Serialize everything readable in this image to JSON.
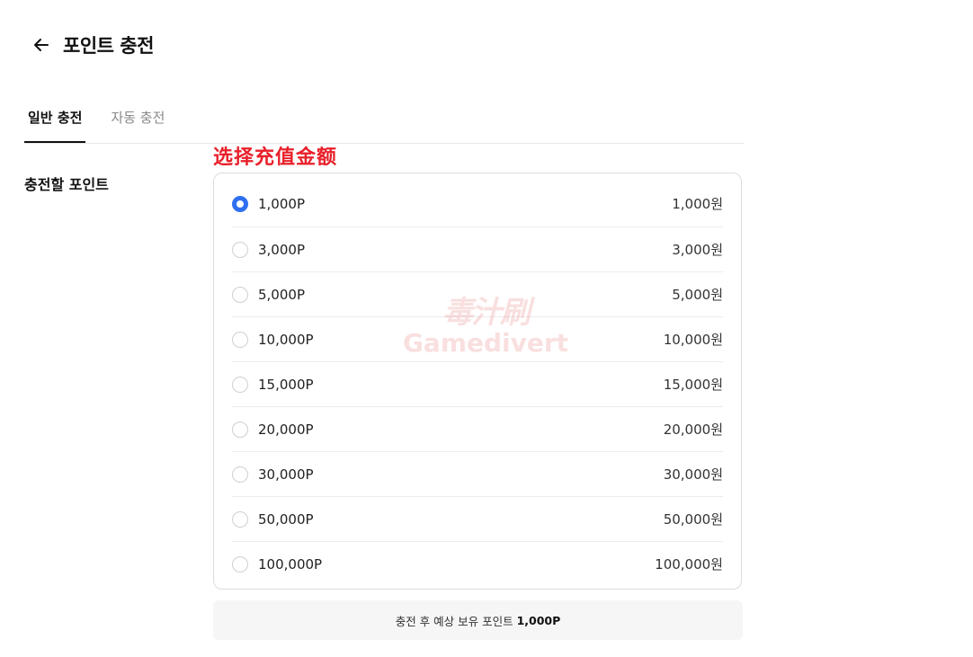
{
  "header": {
    "title": "포인트 충전"
  },
  "tabs": [
    {
      "label": "일반 충전",
      "active": true
    },
    {
      "label": "자동 충전",
      "active": false
    }
  ],
  "section_label": "충전할 포인트",
  "annotation": "选择充值金额",
  "options": [
    {
      "label": "1,000P",
      "price": "1,000원",
      "selected": true
    },
    {
      "label": "3,000P",
      "price": "3,000원",
      "selected": false
    },
    {
      "label": "5,000P",
      "price": "5,000원",
      "selected": false
    },
    {
      "label": "10,000P",
      "price": "10,000원",
      "selected": false
    },
    {
      "label": "15,000P",
      "price": "15,000원",
      "selected": false
    },
    {
      "label": "20,000P",
      "price": "20,000원",
      "selected": false
    },
    {
      "label": "30,000P",
      "price": "30,000원",
      "selected": false
    },
    {
      "label": "50,000P",
      "price": "50,000원",
      "selected": false
    },
    {
      "label": "100,000P",
      "price": "100,000원",
      "selected": false
    }
  ],
  "summary": {
    "label": "충전 후 예상 보유 포인트",
    "value": "1,000P"
  },
  "watermark": {
    "top": "毒汁刷",
    "bottom": "Gamedivert"
  },
  "colors": {
    "accent": "#2f6ff0",
    "annotation": "#e8202a",
    "summary_bg": "#f6f6f6"
  },
  "icons": {
    "back": "arrow-left-icon"
  }
}
